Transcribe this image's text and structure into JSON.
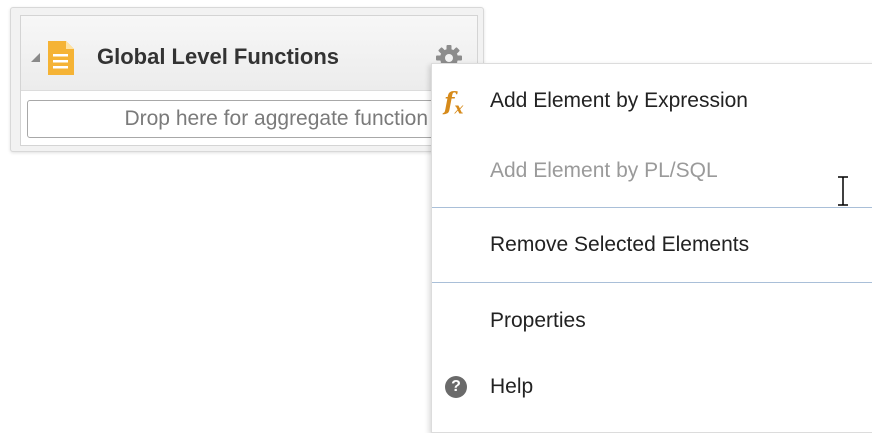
{
  "panel": {
    "title": "Global Level Functions",
    "drop_placeholder": "Drop here for aggregate function",
    "icons": {
      "collapse": "collapse-triangle-icon",
      "document": "document-icon",
      "gear": "gear-icon"
    },
    "colors": {
      "document_icon": "#f5b335",
      "gear_icon": "#8c8c8c"
    }
  },
  "context_menu": {
    "items": [
      {
        "label": "Add Element by Expression",
        "icon": "fx",
        "enabled": true
      },
      {
        "label": "Add Element by PL/SQL",
        "icon": null,
        "enabled": false
      },
      {
        "label": "Remove Selected Elements",
        "icon": null,
        "enabled": true
      },
      {
        "label": "Properties",
        "icon": null,
        "enabled": true
      },
      {
        "label": "Help",
        "icon": "?",
        "enabled": true
      }
    ],
    "icon_texts": {
      "fx": "f",
      "fx_sub": "x",
      "help": "?"
    },
    "colors": {
      "separator": "#a9bfd8",
      "fx_icon": "#d68a1a",
      "disabled_text": "#9a9a9a"
    }
  },
  "cursor": {
    "type": "text-ibeam"
  }
}
